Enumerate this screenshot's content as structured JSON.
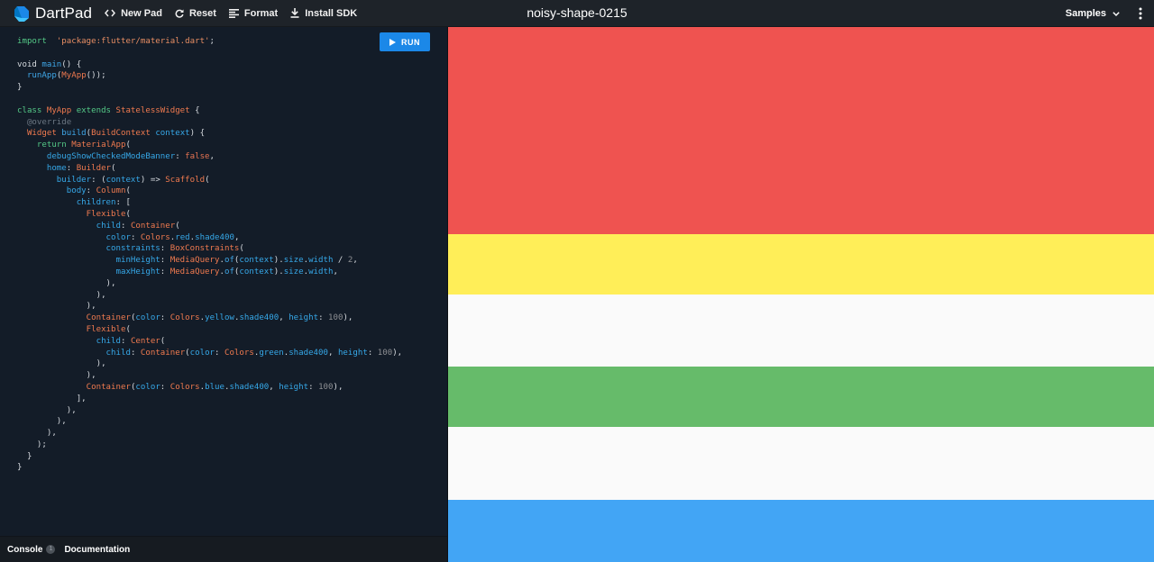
{
  "header": {
    "app_name": "DartPad",
    "new_pad_label": "New Pad",
    "reset_label": "Reset",
    "format_label": "Format",
    "install_sdk_label": "Install SDK",
    "pad_title": "noisy-shape-0215",
    "samples_label": "Samples",
    "icons": {
      "logo": "dart-logo-icon",
      "new_pad": "code-brackets-icon",
      "reset": "refresh-icon",
      "format": "format-align-icon",
      "install_sdk": "download-icon",
      "samples": "chevron-down-icon",
      "more": "more-vert-icon"
    }
  },
  "editor": {
    "run_label": "RUN",
    "run_icon": "play-icon",
    "code_lines": [
      [
        [
          "kw",
          "import"
        ],
        [
          "",
          "  "
        ],
        [
          "str",
          "'package:flutter/material.dart'"
        ],
        [
          "",
          ";"
        ]
      ],
      [],
      [
        [
          "",
          "void "
        ],
        [
          "fn",
          "main"
        ],
        [
          "",
          "() {"
        ]
      ],
      [
        [
          "",
          "  "
        ],
        [
          "fn",
          "runApp"
        ],
        [
          "",
          "("
        ],
        [
          "cls",
          "MyApp"
        ],
        [
          "",
          "());"
        ]
      ],
      [
        [
          "",
          "}"
        ]
      ],
      [],
      [
        [
          "kw",
          "class"
        ],
        [
          "cls",
          " MyApp "
        ],
        [
          "kw",
          "extends"
        ],
        [
          "cls",
          " StatelessWidget"
        ],
        [
          "",
          " {"
        ]
      ],
      [
        [
          "cm",
          "  @override"
        ]
      ],
      [
        [
          "cls",
          "  Widget "
        ],
        [
          "fn",
          "build"
        ],
        [
          "",
          "("
        ],
        [
          "cls",
          "BuildContext"
        ],
        [
          "prop",
          " context"
        ],
        [
          "",
          ") {"
        ]
      ],
      [
        [
          "kw",
          "    return "
        ],
        [
          "cls",
          "MaterialApp"
        ],
        [
          "",
          "("
        ]
      ],
      [
        [
          "prop",
          "      debugShowCheckedModeBanner"
        ],
        [
          "",
          ": "
        ],
        [
          "lit",
          "false"
        ],
        [
          "",
          ","
        ]
      ],
      [
        [
          "prop",
          "      home"
        ],
        [
          "",
          ": "
        ],
        [
          "cls",
          "Builder"
        ],
        [
          "",
          "("
        ]
      ],
      [
        [
          "prop",
          "        builder"
        ],
        [
          "",
          ": ("
        ],
        [
          "prop",
          "context"
        ],
        [
          "",
          ") => "
        ],
        [
          "cls",
          "Scaffold"
        ],
        [
          "",
          "("
        ]
      ],
      [
        [
          "prop",
          "          body"
        ],
        [
          "",
          ": "
        ],
        [
          "cls",
          "Column"
        ],
        [
          "",
          "("
        ]
      ],
      [
        [
          "prop",
          "            children"
        ],
        [
          "",
          ": ["
        ]
      ],
      [
        [
          "cls",
          "              Flexible"
        ],
        [
          "",
          "("
        ]
      ],
      [
        [
          "prop",
          "                child"
        ],
        [
          "",
          ": "
        ],
        [
          "cls",
          "Container"
        ],
        [
          "",
          "("
        ]
      ],
      [
        [
          "prop",
          "                  color"
        ],
        [
          "",
          ": "
        ],
        [
          "cls",
          "Colors"
        ],
        [
          "",
          "."
        ],
        [
          "prop",
          "red"
        ],
        [
          "",
          "."
        ],
        [
          "prop",
          "shade400"
        ],
        [
          "",
          ","
        ]
      ],
      [
        [
          "prop",
          "                  constraints"
        ],
        [
          "",
          ": "
        ],
        [
          "cls",
          "BoxConstraints"
        ],
        [
          "",
          "("
        ]
      ],
      [
        [
          "prop",
          "                    minHeight"
        ],
        [
          "",
          ": "
        ],
        [
          "cls",
          "MediaQuery"
        ],
        [
          "",
          "."
        ],
        [
          "fn",
          "of"
        ],
        [
          "",
          "("
        ],
        [
          "prop",
          "context"
        ],
        [
          "",
          ")."
        ],
        [
          "prop",
          "size"
        ],
        [
          "",
          "."
        ],
        [
          "prop",
          "width"
        ],
        [
          "",
          " / "
        ],
        [
          "num",
          "2"
        ],
        [
          "",
          ","
        ]
      ],
      [
        [
          "prop",
          "                    maxHeight"
        ],
        [
          "",
          ": "
        ],
        [
          "cls",
          "MediaQuery"
        ],
        [
          "",
          "."
        ],
        [
          "fn",
          "of"
        ],
        [
          "",
          "("
        ],
        [
          "prop",
          "context"
        ],
        [
          "",
          ")."
        ],
        [
          "prop",
          "size"
        ],
        [
          "",
          "."
        ],
        [
          "prop",
          "width"
        ],
        [
          "",
          ","
        ]
      ],
      [
        [
          "",
          "                  ),"
        ]
      ],
      [
        [
          "",
          "                ),"
        ]
      ],
      [
        [
          "",
          "              ),"
        ]
      ],
      [
        [
          "cls",
          "              Container"
        ],
        [
          "",
          "("
        ],
        [
          "prop",
          "color"
        ],
        [
          "",
          ": "
        ],
        [
          "cls",
          "Colors"
        ],
        [
          "",
          "."
        ],
        [
          "prop",
          "yellow"
        ],
        [
          "",
          "."
        ],
        [
          "prop",
          "shade400"
        ],
        [
          "",
          ", "
        ],
        [
          "prop",
          "height"
        ],
        [
          "",
          ": "
        ],
        [
          "num",
          "100"
        ],
        [
          "",
          "),"
        ]
      ],
      [
        [
          "cls",
          "              Flexible"
        ],
        [
          "",
          "("
        ]
      ],
      [
        [
          "prop",
          "                child"
        ],
        [
          "",
          ": "
        ],
        [
          "cls",
          "Center"
        ],
        [
          "",
          "("
        ]
      ],
      [
        [
          "prop",
          "                  child"
        ],
        [
          "",
          ": "
        ],
        [
          "cls",
          "Container"
        ],
        [
          "",
          "("
        ],
        [
          "prop",
          "color"
        ],
        [
          "",
          ": "
        ],
        [
          "cls",
          "Colors"
        ],
        [
          "",
          "."
        ],
        [
          "prop",
          "green"
        ],
        [
          "",
          "."
        ],
        [
          "prop",
          "shade400"
        ],
        [
          "",
          ", "
        ],
        [
          "prop",
          "height"
        ],
        [
          "",
          ": "
        ],
        [
          "num",
          "100"
        ],
        [
          "",
          "),"
        ]
      ],
      [
        [
          "",
          "                ),"
        ]
      ],
      [
        [
          "",
          "              ),"
        ]
      ],
      [
        [
          "cls",
          "              Container"
        ],
        [
          "",
          "("
        ],
        [
          "prop",
          "color"
        ],
        [
          "",
          ": "
        ],
        [
          "cls",
          "Colors"
        ],
        [
          "",
          "."
        ],
        [
          "prop",
          "blue"
        ],
        [
          "",
          "."
        ],
        [
          "prop",
          "shade400"
        ],
        [
          "",
          ", "
        ],
        [
          "prop",
          "height"
        ],
        [
          "",
          ": "
        ],
        [
          "num",
          "100"
        ],
        [
          "",
          "),"
        ]
      ],
      [
        [
          "",
          "            ],"
        ]
      ],
      [
        [
          "",
          "          ),"
        ]
      ],
      [
        [
          "",
          "        ),"
        ]
      ],
      [
        [
          "",
          "      ),"
        ]
      ],
      [
        [
          "",
          "    );"
        ]
      ],
      [
        [
          "",
          "  }"
        ]
      ],
      [
        [
          "",
          "}"
        ]
      ]
    ]
  },
  "bottom_bar": {
    "console_label": "Console",
    "console_count": "1",
    "documentation_label": "Documentation"
  },
  "preview": {
    "blocks": [
      {
        "name": "red-container",
        "color": "#ef5350"
      },
      {
        "name": "yellow-container",
        "color": "#ffee58"
      },
      {
        "name": "flexible-space",
        "color": "#fafafa"
      },
      {
        "name": "green-container",
        "color": "#66bb6a"
      },
      {
        "name": "flexible-space",
        "color": "#fafafa"
      },
      {
        "name": "blue-container",
        "color": "#42a5f5"
      }
    ]
  },
  "colors": {
    "topbar": "#1e2329",
    "editor_bg": "#131c28",
    "run_button": "#1b88e8"
  }
}
